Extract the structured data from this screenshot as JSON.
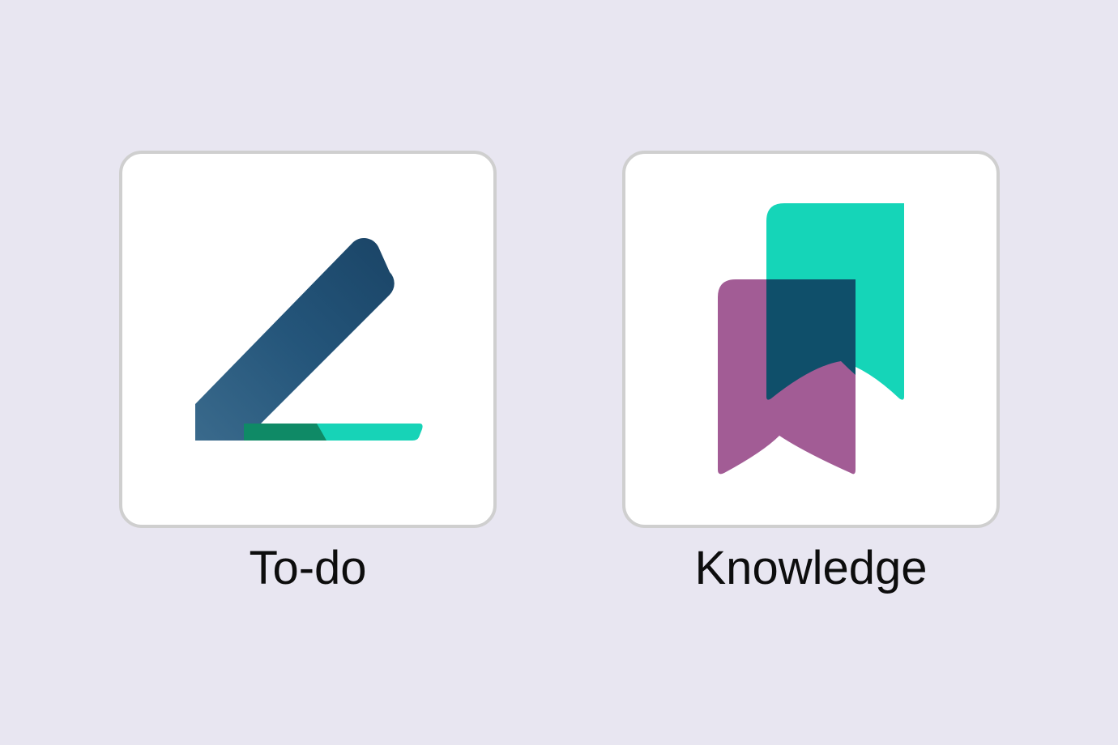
{
  "apps": [
    {
      "id": "todo",
      "label": "To-do",
      "icon": "pencil-check-icon",
      "colors": {
        "primary": "#1f4b6e",
        "accent": "#17d3b7",
        "accent_dark": "#0f8a66"
      }
    },
    {
      "id": "knowledge",
      "label": "Knowledge",
      "icon": "bookmarks-icon",
      "colors": {
        "teal": "#15d5b8",
        "purple": "#a25c95",
        "overlap": "#0f4f6a"
      }
    }
  ],
  "background_color": "#e8e6f1",
  "tile_border_color": "#cfcfcf"
}
